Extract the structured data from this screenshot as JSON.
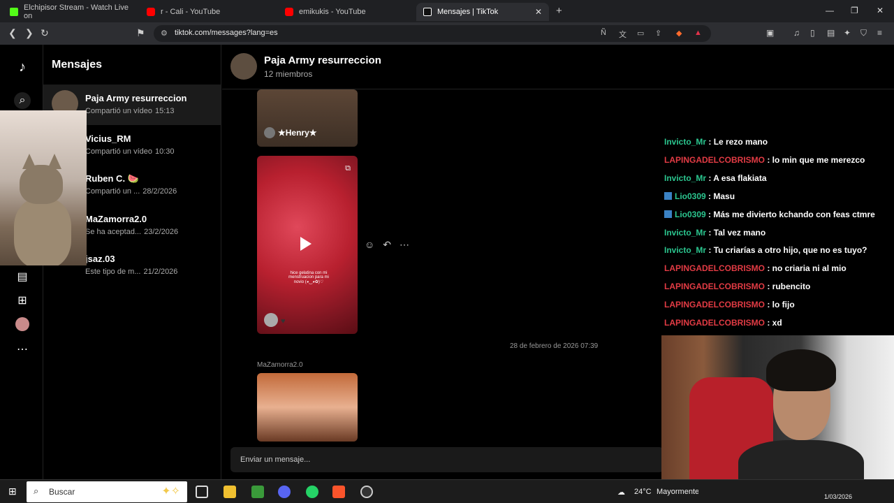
{
  "browser": {
    "tabs": [
      {
        "title": "Elchipisor Stream - Watch Live on",
        "color": "#53fc18"
      },
      {
        "title": "r - Cali - YouTube",
        "color": "#ff0000"
      },
      {
        "title": "emikukis - YouTube",
        "color": "#ff0000"
      },
      {
        "title": "Mensajes | TikTok",
        "color": "#ffffff"
      }
    ],
    "url": "tiktok.com/messages?lang=es"
  },
  "sidebar": {
    "title": "Mensajes",
    "conversations": [
      {
        "name": "Paja Army resurreccion",
        "preview": "Compartió un vídeo",
        "time": "15:13"
      },
      {
        "name": "Vicius_RM",
        "preview": "Compartió un vídeo",
        "time": "10:30"
      },
      {
        "name": "Ruben C. 🍉",
        "preview": "Compartió un ...",
        "time": "28/2/2026"
      },
      {
        "name": "MaZamorra2.0",
        "preview": "Se ha aceptad...",
        "time": "23/2/2026"
      },
      {
        "name": "jsaz.03",
        "preview": "Este tipo de m...",
        "time": "21/2/2026"
      }
    ]
  },
  "chat": {
    "title": "Paja Army resurreccion",
    "members": "12 miembros",
    "media1_user": "★Henry★",
    "media2_caption": "hice gelatina con mi menstruacion para mi novio (◕‿◕✿)♡",
    "date_separator": "28 de febrero de 2026 07:39",
    "sender": "MaZamorra2.0",
    "composer_placeholder": "Enviar un mensaje..."
  },
  "stream_chat": [
    {
      "user": "Invicto_Mr",
      "color": "green",
      "badge": false,
      "text": ": Le rezo mano"
    },
    {
      "user": "LAPINGADELCOBRISMO",
      "color": "red",
      "badge": false,
      "text": ": lo min que me merezco"
    },
    {
      "user": "Invicto_Mr",
      "color": "green",
      "badge": false,
      "text": ": A esa flakiata"
    },
    {
      "user": "Lio0309",
      "color": "green",
      "badge": true,
      "text": ": Masu"
    },
    {
      "user": "Lio0309",
      "color": "green",
      "badge": true,
      "text": ": Más me divierto kchando con feas ctmre"
    },
    {
      "user": "Invicto_Mr",
      "color": "green",
      "badge": false,
      "text": ": Tal vez mano"
    },
    {
      "user": "Invicto_Mr",
      "color": "green",
      "badge": false,
      "text": ": Tu criarías a otro hijo, que no es tuyo?"
    },
    {
      "user": "LAPINGADELCOBRISMO",
      "color": "red",
      "badge": false,
      "text": ": no criaria ni al mio"
    },
    {
      "user": "LAPINGADELCOBRISMO",
      "color": "red",
      "badge": false,
      "text": ": rubencito"
    },
    {
      "user": "LAPINGADELCOBRISMO",
      "color": "red",
      "badge": false,
      "text": ": lo fijo"
    },
    {
      "user": "LAPINGADELCOBRISMO",
      "color": "red",
      "badge": false,
      "text": ": xd"
    }
  ],
  "taskbar": {
    "search_label": "Buscar",
    "weather": "24°C",
    "weather_news": "Mayormente nublado",
    "date": "1/03/2026"
  }
}
